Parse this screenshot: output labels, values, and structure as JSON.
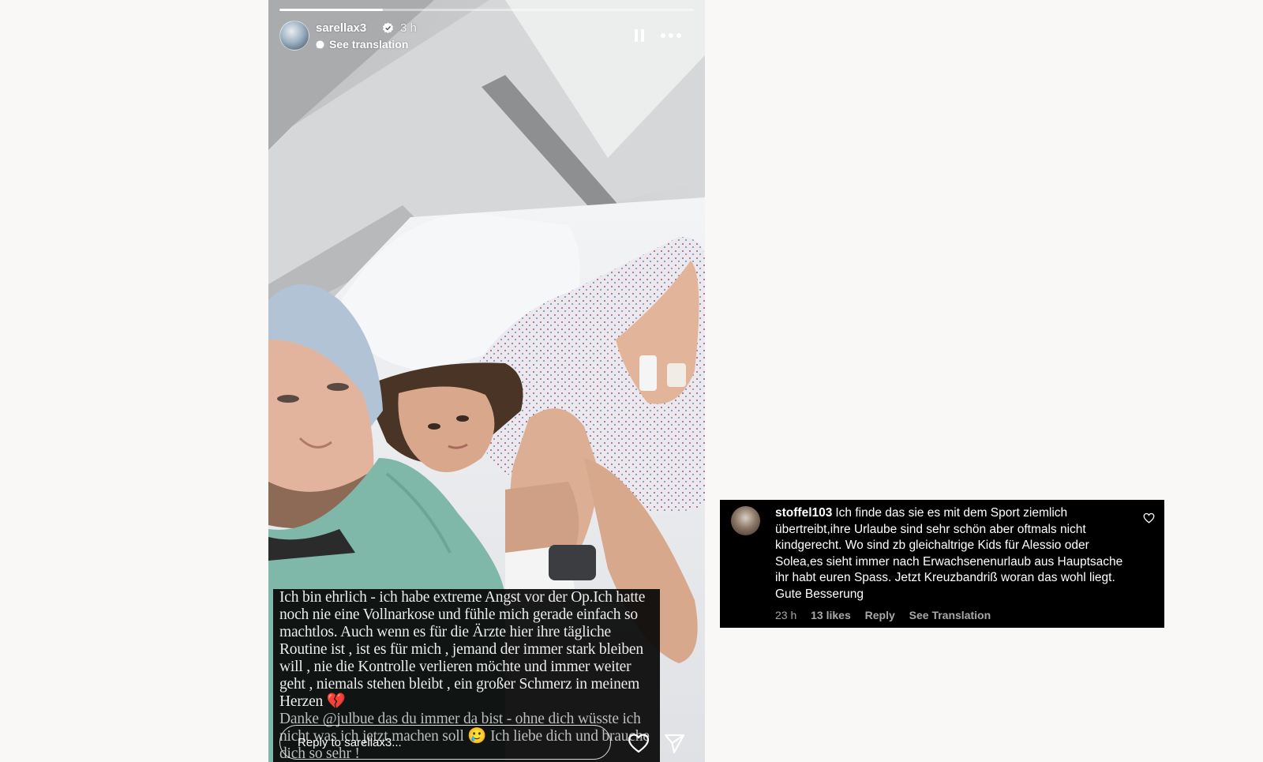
{
  "story": {
    "username": "sarellax3",
    "time": "3 h",
    "see_translation": "See translation",
    "progress": 0.25,
    "caption_main": "Ich bin ehrlich - ich habe extreme Angst vor der Op.Ich hatte noch nie eine Vollnarkose und fühle mich gerade einfach so machtlos. Auch wenn es für die Ärzte hier ihre tägliche Routine ist , ist es für mich , jemand der immer stark bleiben will , nie die Kontrolle verlieren möchte und immer weiter geht , niemals stehen bleibt , ein großer Schmerz in meinem Herzen 💔",
    "caption_thanks": "Danke @julbue das du immer da bist - ohne dich wüsste ich nicht was ich jetzt machen soll 🥲 Ich liebe dich und brauche dich so sehr !",
    "reply_placeholder": "Reply to sarellax3...",
    "icons": [
      "verified-icon",
      "translate-icon",
      "pause-icon",
      "more-icon",
      "heart-icon",
      "send-icon"
    ]
  },
  "comment": {
    "username": "stoffel103",
    "text": "Ich finde das sie es mit dem Sport ziemlich übertreibt,ihre Urlaube sind sehr schön aber oftmals nicht kindgerecht. Wo sind zb gleichaltrige Kids für Alessio oder Solea,es sieht immer nach Erwachsenenurlaub aus Hauptsache ihr habt euren Spass. Jetzt Kreuzbandriß woran das wohl liegt. Gute Besserung",
    "time": "23 h",
    "likes": "13 likes",
    "reply": "Reply",
    "see_translation": "See Translation"
  }
}
